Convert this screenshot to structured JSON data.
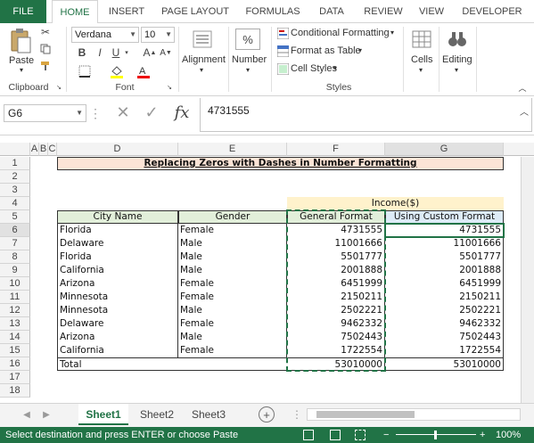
{
  "tabs": [
    "FILE",
    "HOME",
    "INSERT",
    "PAGE LAYOUT",
    "FORMULAS",
    "DATA",
    "REVIEW",
    "VIEW",
    "DEVELOPER"
  ],
  "ribbon": {
    "clipboard": {
      "paste": "Paste",
      "label": "Clipboard"
    },
    "font": {
      "name": "Verdana",
      "size": "10",
      "label": "Font",
      "bold": "B",
      "italic": "I",
      "underline": "U"
    },
    "alignment": {
      "label": "Alignment"
    },
    "number": {
      "label": "Number",
      "symbol": "%"
    },
    "styles": {
      "conditional": "Conditional Formatting",
      "format_table": "Format as Table",
      "cell_styles": "Cell Styles",
      "label": "Styles"
    },
    "cells": {
      "label": "Cells"
    },
    "editing": {
      "label": "Editing"
    }
  },
  "formula_bar": {
    "name_box": "G6",
    "fx": "fx",
    "value": "4731555"
  },
  "columns": [
    "A",
    "B",
    "C",
    "D",
    "E",
    "F",
    "G"
  ],
  "rows": [
    "1",
    "2",
    "3",
    "4",
    "5",
    "6",
    "7",
    "8",
    "9",
    "10",
    "11",
    "12",
    "13",
    "14",
    "15",
    "16",
    "17",
    "18"
  ],
  "sheet": {
    "title": "Replacing Zeros with Dashes in Number Formatting",
    "income_header": "Income($)",
    "headers": [
      "City Name",
      "Gender",
      "General Format",
      "Using Custom Format"
    ],
    "data": [
      [
        "Florida",
        "Female",
        "4731555",
        "4731555"
      ],
      [
        "Delaware",
        "Male",
        "11001666",
        "11001666"
      ],
      [
        "Florida",
        "Male",
        "5501777",
        "5501777"
      ],
      [
        "California",
        "Male",
        "2001888",
        "2001888"
      ],
      [
        "Arizona",
        "Female",
        "6451999",
        "6451999"
      ],
      [
        "Minnesota",
        "Female",
        "2150211",
        "2150211"
      ],
      [
        "Minnesota",
        "Male",
        "2502221",
        "2502221"
      ],
      [
        "Delaware",
        "Female",
        "9462332",
        "9462332"
      ],
      [
        "Arizona",
        "Male",
        "7502443",
        "7502443"
      ],
      [
        "California",
        "Female",
        "1722554",
        "1722554"
      ]
    ],
    "total": [
      "Total",
      "",
      "53010000",
      "53010000"
    ]
  },
  "sheet_tabs": [
    "Sheet1",
    "Sheet2",
    "Sheet3"
  ],
  "status": {
    "message": "Select destination and press ENTER or choose Paste",
    "zoom": "100%"
  },
  "colors": {
    "accent": "#217346",
    "title_fill": "#fce4d6",
    "header_fill": "#e2efda",
    "income_fill": "#fff2cc",
    "custom_header_fill": "#ddebf7"
  }
}
